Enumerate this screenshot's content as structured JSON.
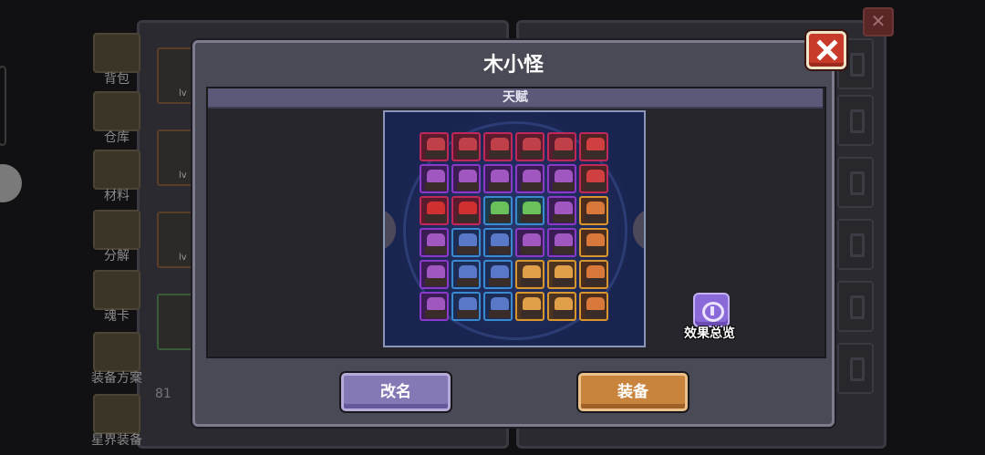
{
  "background": {
    "side_tabs": [
      "背包",
      "仓库",
      "材料",
      "分解",
      "魂卡",
      "装备方案",
      "星界装备"
    ],
    "slot_level_label": "lv",
    "stat_text": "81",
    "close_symbol": "✕"
  },
  "modal": {
    "title": "木小怪",
    "section_title": "天赋",
    "close_symbol": "✕",
    "effect_overview_label": "效果总览",
    "rename_label": "改名",
    "equip_label": "装备"
  },
  "colors": {
    "red_column": "#c0285a",
    "purple_column": "#8a3ac8",
    "gold_column": "#d8962e",
    "teal_column": "#3a8ad0",
    "modal_bg": "#4a4a56",
    "rename_button": "#8678b4",
    "equip_button": "#c8843c",
    "close_button": "#c83a2a"
  },
  "talent_grid": {
    "rows": [
      [
        "red-demon",
        "red-demon",
        "red-demon",
        "red-demon",
        "red-demon",
        "mushroom"
      ],
      [
        "purple-demon",
        "purple-demon",
        "purple-demon",
        "purple-demon",
        "purple-demon",
        "mushroom"
      ],
      [
        "red-orb",
        "red-orb",
        "green-goblin",
        "green-goblin",
        "purple-demon",
        "orange-warrior"
      ],
      [
        "purple-demon",
        "blue-knight",
        "blue-knight",
        "purple-demon",
        "purple-demon",
        "orange-warrior"
      ],
      [
        "purple-demon",
        "blue-knight",
        "blue-knight",
        "gold-beast",
        "gold-beast",
        "orange-warrior"
      ],
      [
        "purple-demon",
        "blue-knight",
        "blue-knight",
        "gold-beast",
        "gold-beast",
        "orange-warrior"
      ]
    ]
  }
}
